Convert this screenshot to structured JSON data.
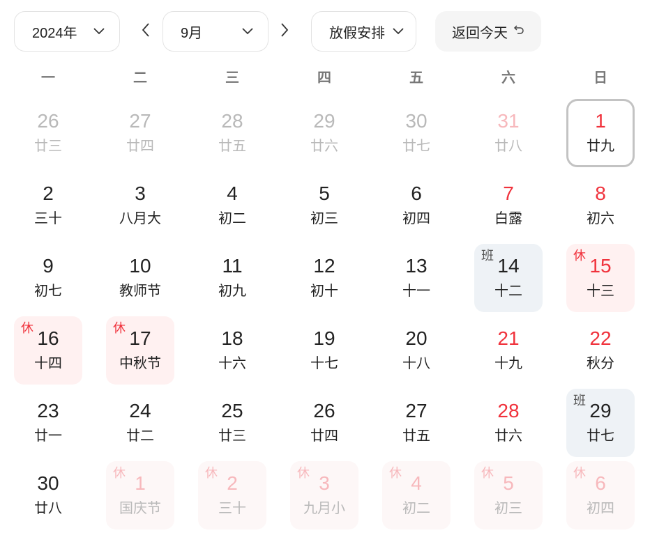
{
  "toolbar": {
    "year_label": "2024年",
    "month_label": "9月",
    "holiday_label": "放假安排",
    "today_label": "返回今天"
  },
  "weekdays": [
    "一",
    "二",
    "三",
    "四",
    "五",
    "六",
    "日"
  ],
  "colors": {
    "holiday_red": "#f0323c",
    "rest_bg": "#fff1f1",
    "work_bg": "#eef2f6",
    "muted": "#b9b9b9"
  },
  "icons": [
    "chevron-down-icon",
    "chevron-left-icon",
    "chevron-right-icon",
    "return-arrow-icon"
  ],
  "tag_labels": {
    "rest": "休",
    "work": "班"
  },
  "weeks": [
    [
      {
        "day": "26",
        "lunar": "廿三",
        "other": true
      },
      {
        "day": "27",
        "lunar": "廿四",
        "other": true
      },
      {
        "day": "28",
        "lunar": "廿五",
        "other": true
      },
      {
        "day": "29",
        "lunar": "廿六",
        "other": true
      },
      {
        "day": "30",
        "lunar": "廿七",
        "other": true
      },
      {
        "day": "31",
        "lunar": "廿八",
        "other": true,
        "red": true
      },
      {
        "day": "1",
        "lunar": "廿九",
        "red": true,
        "today": true
      }
    ],
    [
      {
        "day": "2",
        "lunar": "三十"
      },
      {
        "day": "3",
        "lunar": "八月大"
      },
      {
        "day": "4",
        "lunar": "初二"
      },
      {
        "day": "5",
        "lunar": "初三"
      },
      {
        "day": "6",
        "lunar": "初四"
      },
      {
        "day": "7",
        "lunar": "白露",
        "red": true
      },
      {
        "day": "8",
        "lunar": "初六",
        "red": true
      }
    ],
    [
      {
        "day": "9",
        "lunar": "初七"
      },
      {
        "day": "10",
        "lunar": "教师节"
      },
      {
        "day": "11",
        "lunar": "初九"
      },
      {
        "day": "12",
        "lunar": "初十"
      },
      {
        "day": "13",
        "lunar": "十一"
      },
      {
        "day": "14",
        "lunar": "十二",
        "tag": "work"
      },
      {
        "day": "15",
        "lunar": "十三",
        "red": true,
        "tag": "rest"
      }
    ],
    [
      {
        "day": "16",
        "lunar": "十四",
        "tag": "rest"
      },
      {
        "day": "17",
        "lunar": "中秋节",
        "tag": "rest"
      },
      {
        "day": "18",
        "lunar": "十六"
      },
      {
        "day": "19",
        "lunar": "十七"
      },
      {
        "day": "20",
        "lunar": "十八"
      },
      {
        "day": "21",
        "lunar": "十九",
        "red": true
      },
      {
        "day": "22",
        "lunar": "秋分",
        "red": true
      }
    ],
    [
      {
        "day": "23",
        "lunar": "廿一"
      },
      {
        "day": "24",
        "lunar": "廿二"
      },
      {
        "day": "25",
        "lunar": "廿三"
      },
      {
        "day": "26",
        "lunar": "廿四"
      },
      {
        "day": "27",
        "lunar": "廿五"
      },
      {
        "day": "28",
        "lunar": "廿六",
        "red": true
      },
      {
        "day": "29",
        "lunar": "廿七",
        "tag": "work"
      }
    ],
    [
      {
        "day": "30",
        "lunar": "廿八"
      },
      {
        "day": "1",
        "lunar": "国庆节",
        "other": true,
        "tag": "rest"
      },
      {
        "day": "2",
        "lunar": "三十",
        "other": true,
        "tag": "rest"
      },
      {
        "day": "3",
        "lunar": "九月小",
        "other": true,
        "tag": "rest"
      },
      {
        "day": "4",
        "lunar": "初二",
        "other": true,
        "tag": "rest"
      },
      {
        "day": "5",
        "lunar": "初三",
        "other": true,
        "red": true,
        "tag": "rest"
      },
      {
        "day": "6",
        "lunar": "初四",
        "other": true,
        "red": true,
        "tag": "rest"
      }
    ]
  ]
}
